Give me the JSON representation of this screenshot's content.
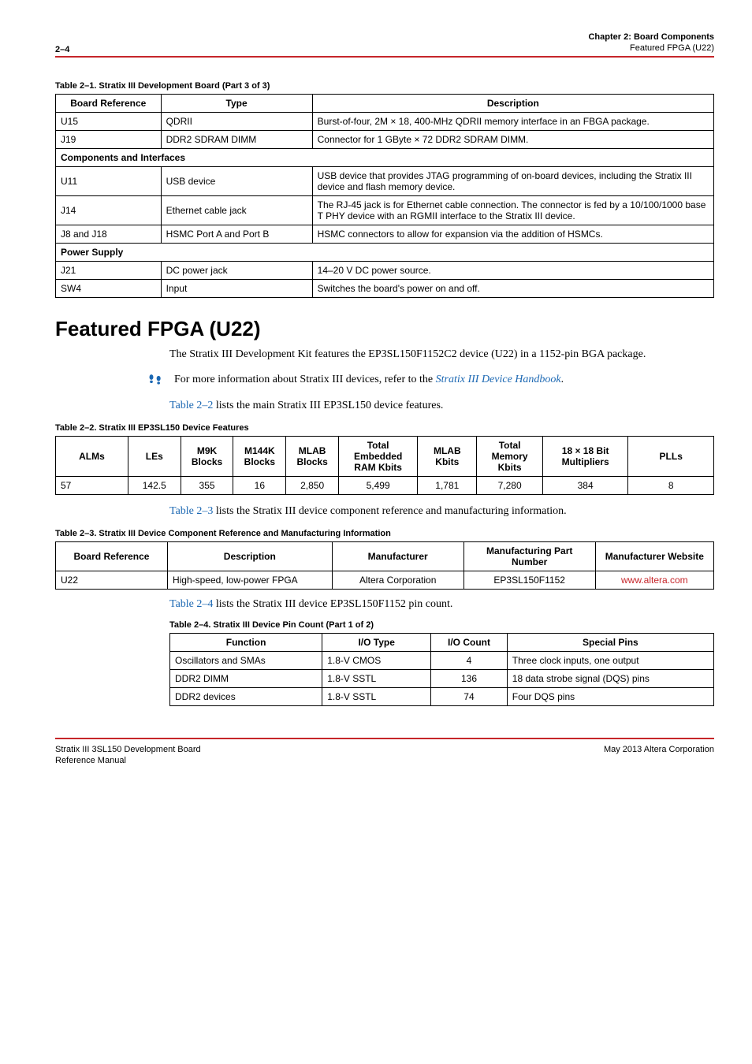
{
  "header": {
    "left": "2–4",
    "right_line1": "Chapter 2: Board Components",
    "right_line2": "Featured FPGA (U22)"
  },
  "table1": {
    "caption": "Table 2–1. Stratix III Development Board (Part 3 of 3)",
    "headers": [
      "Board Reference",
      "Type",
      "Description"
    ],
    "rows": [
      {
        "ref": "U15",
        "type": "QDRII",
        "desc": "Burst-of-four, 2M × 18, 400-MHz QDRII memory interface in an FBGA package."
      },
      {
        "ref": "J19",
        "type": "DDR2 SDRAM DIMM",
        "desc": "Connector for 1 GByte × 72 DDR2 SDRAM DIMM."
      }
    ],
    "section2": "Components and Interfaces",
    "rows2": [
      {
        "ref": "U11",
        "type": "USB device",
        "desc": "USB device that provides JTAG programming of on-board devices, including the Stratix III device and flash memory device."
      },
      {
        "ref": "J14",
        "type": "Ethernet cable jack",
        "desc": "The RJ-45 jack is for Ethernet cable connection. The connector is fed by a 10/100/1000 base T PHY device with an RGMII interface to the Stratix III device."
      },
      {
        "ref": "J8 and J18",
        "type": "HSMC Port A and Port B",
        "desc": "HSMC connectors to allow for expansion via the addition of HSMCs."
      }
    ],
    "section3": "Power Supply",
    "rows3": [
      {
        "ref": "J21",
        "type": "DC power jack",
        "desc": "14–20 V DC power source."
      },
      {
        "ref": "SW4",
        "type": "Input",
        "desc": "Switches the board's power on and off."
      }
    ]
  },
  "featured": {
    "heading": "Featured FPGA (U22)",
    "para1": "The Stratix III Development Kit features the EP3SL150F1152C2 device (U22) in a 1152-pin BGA package.",
    "ref_text_pre": "For more information about Stratix III devices, refer to the ",
    "ref_link": "Stratix III Device Handbook",
    "ref_text_post": ".",
    "para2_pre": "Table 2–2",
    "para2": " lists the main Stratix III EP3SL150 device features."
  },
  "table2": {
    "caption": "Table 2–2. Stratix III EP3SL150 Device Features",
    "headers": [
      "ALMs",
      "LEs",
      "M9K Blocks",
      "M144K Blocks",
      "MLAB Blocks",
      "Total Embedded RAM Kbits",
      "MLAB Kbits",
      "Total Memory Kbits",
      "18 × 18 Bit Multipliers",
      "PLLs"
    ],
    "row": [
      "57",
      "142.5",
      "355",
      "16",
      "2,850",
      "5,499",
      "1,781",
      "7,280",
      "384",
      "8"
    ]
  },
  "para3_pre": "Table 2–3",
  "para3": " lists the Stratix III device component reference and manufacturing information.",
  "table3": {
    "caption": "Table 2–3. Stratix III Device Component Reference and Manufacturing Information",
    "headers": [
      "Board Reference",
      "Description",
      "Manufacturer",
      "Manufacturing Part Number",
      "Manufacturer Website"
    ],
    "row": {
      "ref": "U22",
      "desc": "High-speed, low-power FPGA",
      "mfr": "Altera Corporation",
      "part": "EP3SL150F1152",
      "site": "www.altera.com"
    }
  },
  "para4_pre": "Table 2–4",
  "para4": " lists the Stratix III device EP3SL150F1152 pin count.",
  "table4": {
    "caption": "Table 2–4. Stratix III Device Pin Count (Part 1 of 2)",
    "headers": [
      "Function",
      "I/O Type",
      "I/O Count",
      "Special Pins"
    ],
    "rows": [
      {
        "fn": "Oscillators and SMAs",
        "io": "1.8-V CMOS",
        "cnt": "4",
        "sp": "Three clock inputs, one output"
      },
      {
        "fn": "DDR2 DIMM",
        "io": "1.8-V SSTL",
        "cnt": "136",
        "sp": "18 data strobe signal (DQS) pins"
      },
      {
        "fn": "DDR2 devices",
        "io": "1.8-V SSTL",
        "cnt": "74",
        "sp": "Four DQS pins"
      }
    ]
  },
  "footer": {
    "left_line1": "Stratix III 3SL150 Development Board",
    "left_line2": "Reference Manual",
    "right": "May 2013  Altera Corporation"
  }
}
